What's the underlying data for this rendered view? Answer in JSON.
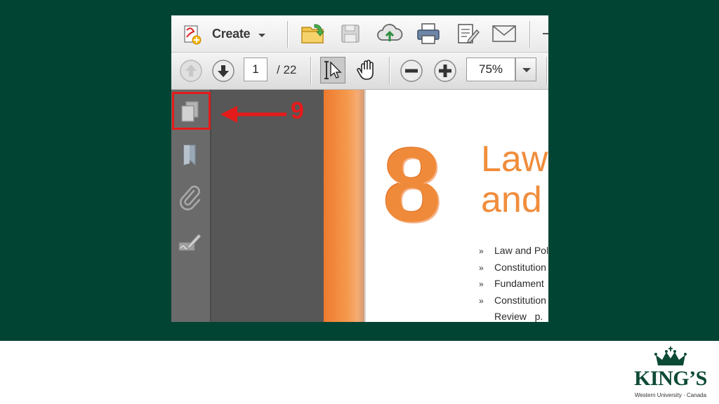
{
  "toolbar": {
    "create_label": "Create",
    "page_current": "1",
    "page_total": "/ 22",
    "zoom_value": "75%"
  },
  "sidebar": {
    "items": [
      {
        "icon": "page-thumbnails-icon"
      },
      {
        "icon": "bookmark-icon"
      },
      {
        "icon": "paperclip-icon"
      },
      {
        "icon": "signature-icon"
      }
    ]
  },
  "callout": {
    "number": "9",
    "color": "#e51b1b"
  },
  "document": {
    "chapter_number": "8",
    "title": "Law\nand",
    "list_items": [
      "Law and Pol",
      "Constitution",
      "Fundament",
      "Constitution"
    ],
    "list_continuation": "Review   p."
  },
  "logo": {
    "name": "KING’S",
    "subtitle": "Western University · Canada"
  },
  "colors": {
    "slide_background": "#024434",
    "accent_orange": "#f08d3c",
    "brand_green": "#0d4a35"
  }
}
